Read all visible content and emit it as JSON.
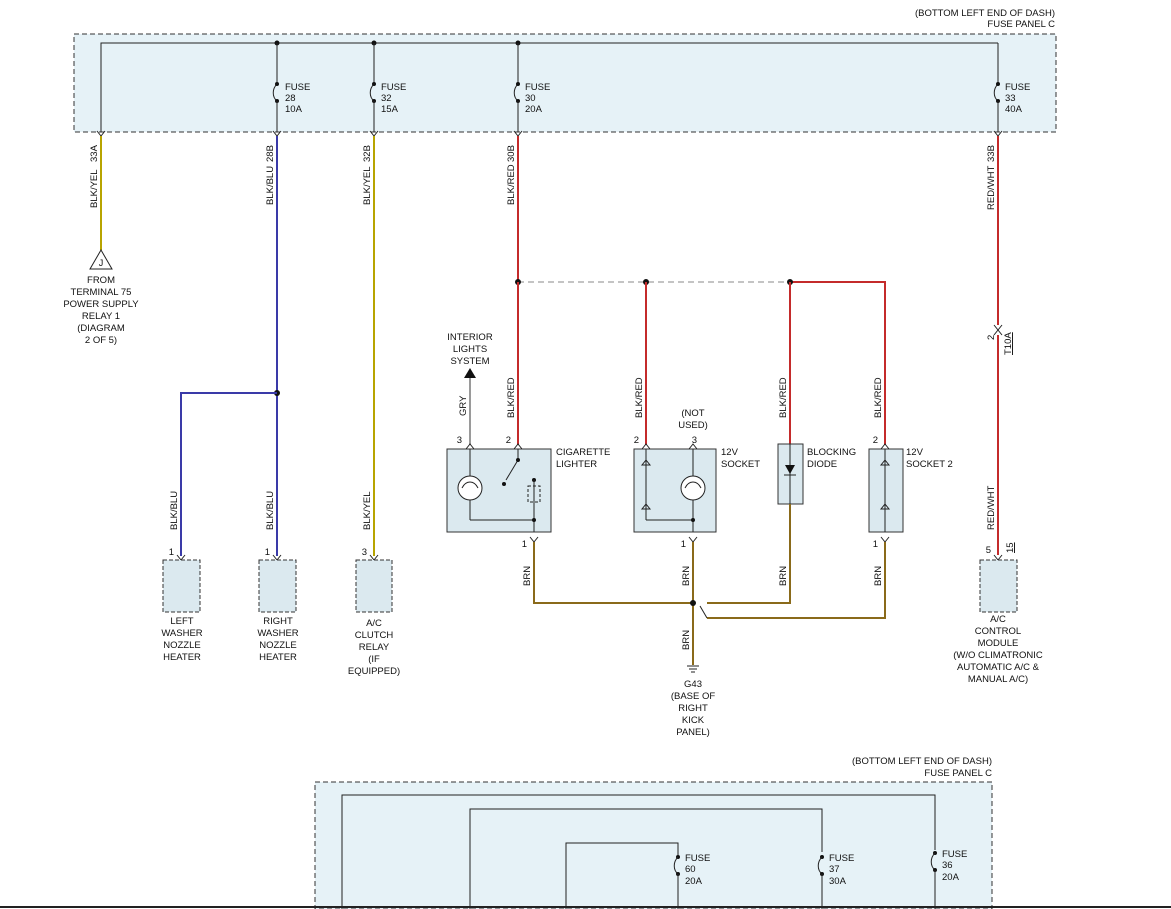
{
  "top_panel": {
    "location": "(BOTTOM LEFT END OF DASH)",
    "name": "FUSE PANEL C",
    "fuses": [
      {
        "word": "FUSE",
        "num": "28",
        "amps": "10A"
      },
      {
        "word": "FUSE",
        "num": "32",
        "amps": "15A"
      },
      {
        "word": "FUSE",
        "num": "30",
        "amps": "20A"
      },
      {
        "word": "FUSE",
        "num": "33",
        "amps": "40A"
      }
    ],
    "terminals": [
      "33A",
      "28B",
      "32B",
      "30B",
      "33B"
    ]
  },
  "wires": {
    "blk_yel": "BLK/YEL",
    "blk_blu": "BLK/BLU",
    "blk_red": "BLK/RED",
    "red_wht": "RED/WHT",
    "gry": "GRY",
    "brn": "BRN"
  },
  "from_terminal": {
    "letter": "J",
    "lines": [
      "FROM",
      "TERMINAL 75",
      "POWER SUPPLY",
      "RELAY 1",
      "(DIAGRAM",
      "2 OF 5)"
    ]
  },
  "interior_lights": {
    "lines": [
      "INTERIOR",
      "LIGHTS",
      "SYSTEM"
    ]
  },
  "connector_t10a": {
    "pin": "2",
    "name": "T10A"
  },
  "pins": {
    "p1": "1",
    "p2": "2",
    "p3": "3",
    "p5": "5",
    "p15": "15"
  },
  "not_used": {
    "lines": [
      "(NOT",
      "USED)"
    ]
  },
  "components": {
    "cigarette_lighter": [
      "CIGARETTE",
      "LIGHTER"
    ],
    "socket_12v": [
      "12V",
      "SOCKET"
    ],
    "blocking_diode": [
      "BLOCKING",
      "DIODE"
    ],
    "socket_12v_2": [
      "12V",
      "SOCKET 2"
    ],
    "left_washer": [
      "LEFT",
      "WASHER",
      "NOZZLE",
      "HEATER"
    ],
    "right_washer": [
      "RIGHT",
      "WASHER",
      "NOZZLE",
      "HEATER"
    ],
    "ac_clutch": [
      "A/C",
      "CLUTCH",
      "RELAY",
      "(IF",
      "EQUIPPED)"
    ],
    "ac_control": [
      "A/C",
      "CONTROL",
      "MODULE",
      "(W/O CLIMATRONIC",
      "AUTOMATIC A/C &",
      "MANUAL A/C)"
    ]
  },
  "ground": {
    "lines": [
      "G43",
      "(BASE OF",
      "RIGHT",
      "KICK",
      "PANEL)"
    ]
  },
  "bottom_panel": {
    "location": "(BOTTOM LEFT END OF DASH)",
    "name": "FUSE PANEL C",
    "fuses": [
      {
        "word": "FUSE",
        "num": "60",
        "amps": "20A"
      },
      {
        "word": "FUSE",
        "num": "37",
        "amps": "30A"
      },
      {
        "word": "FUSE",
        "num": "36",
        "amps": "20A"
      }
    ]
  }
}
